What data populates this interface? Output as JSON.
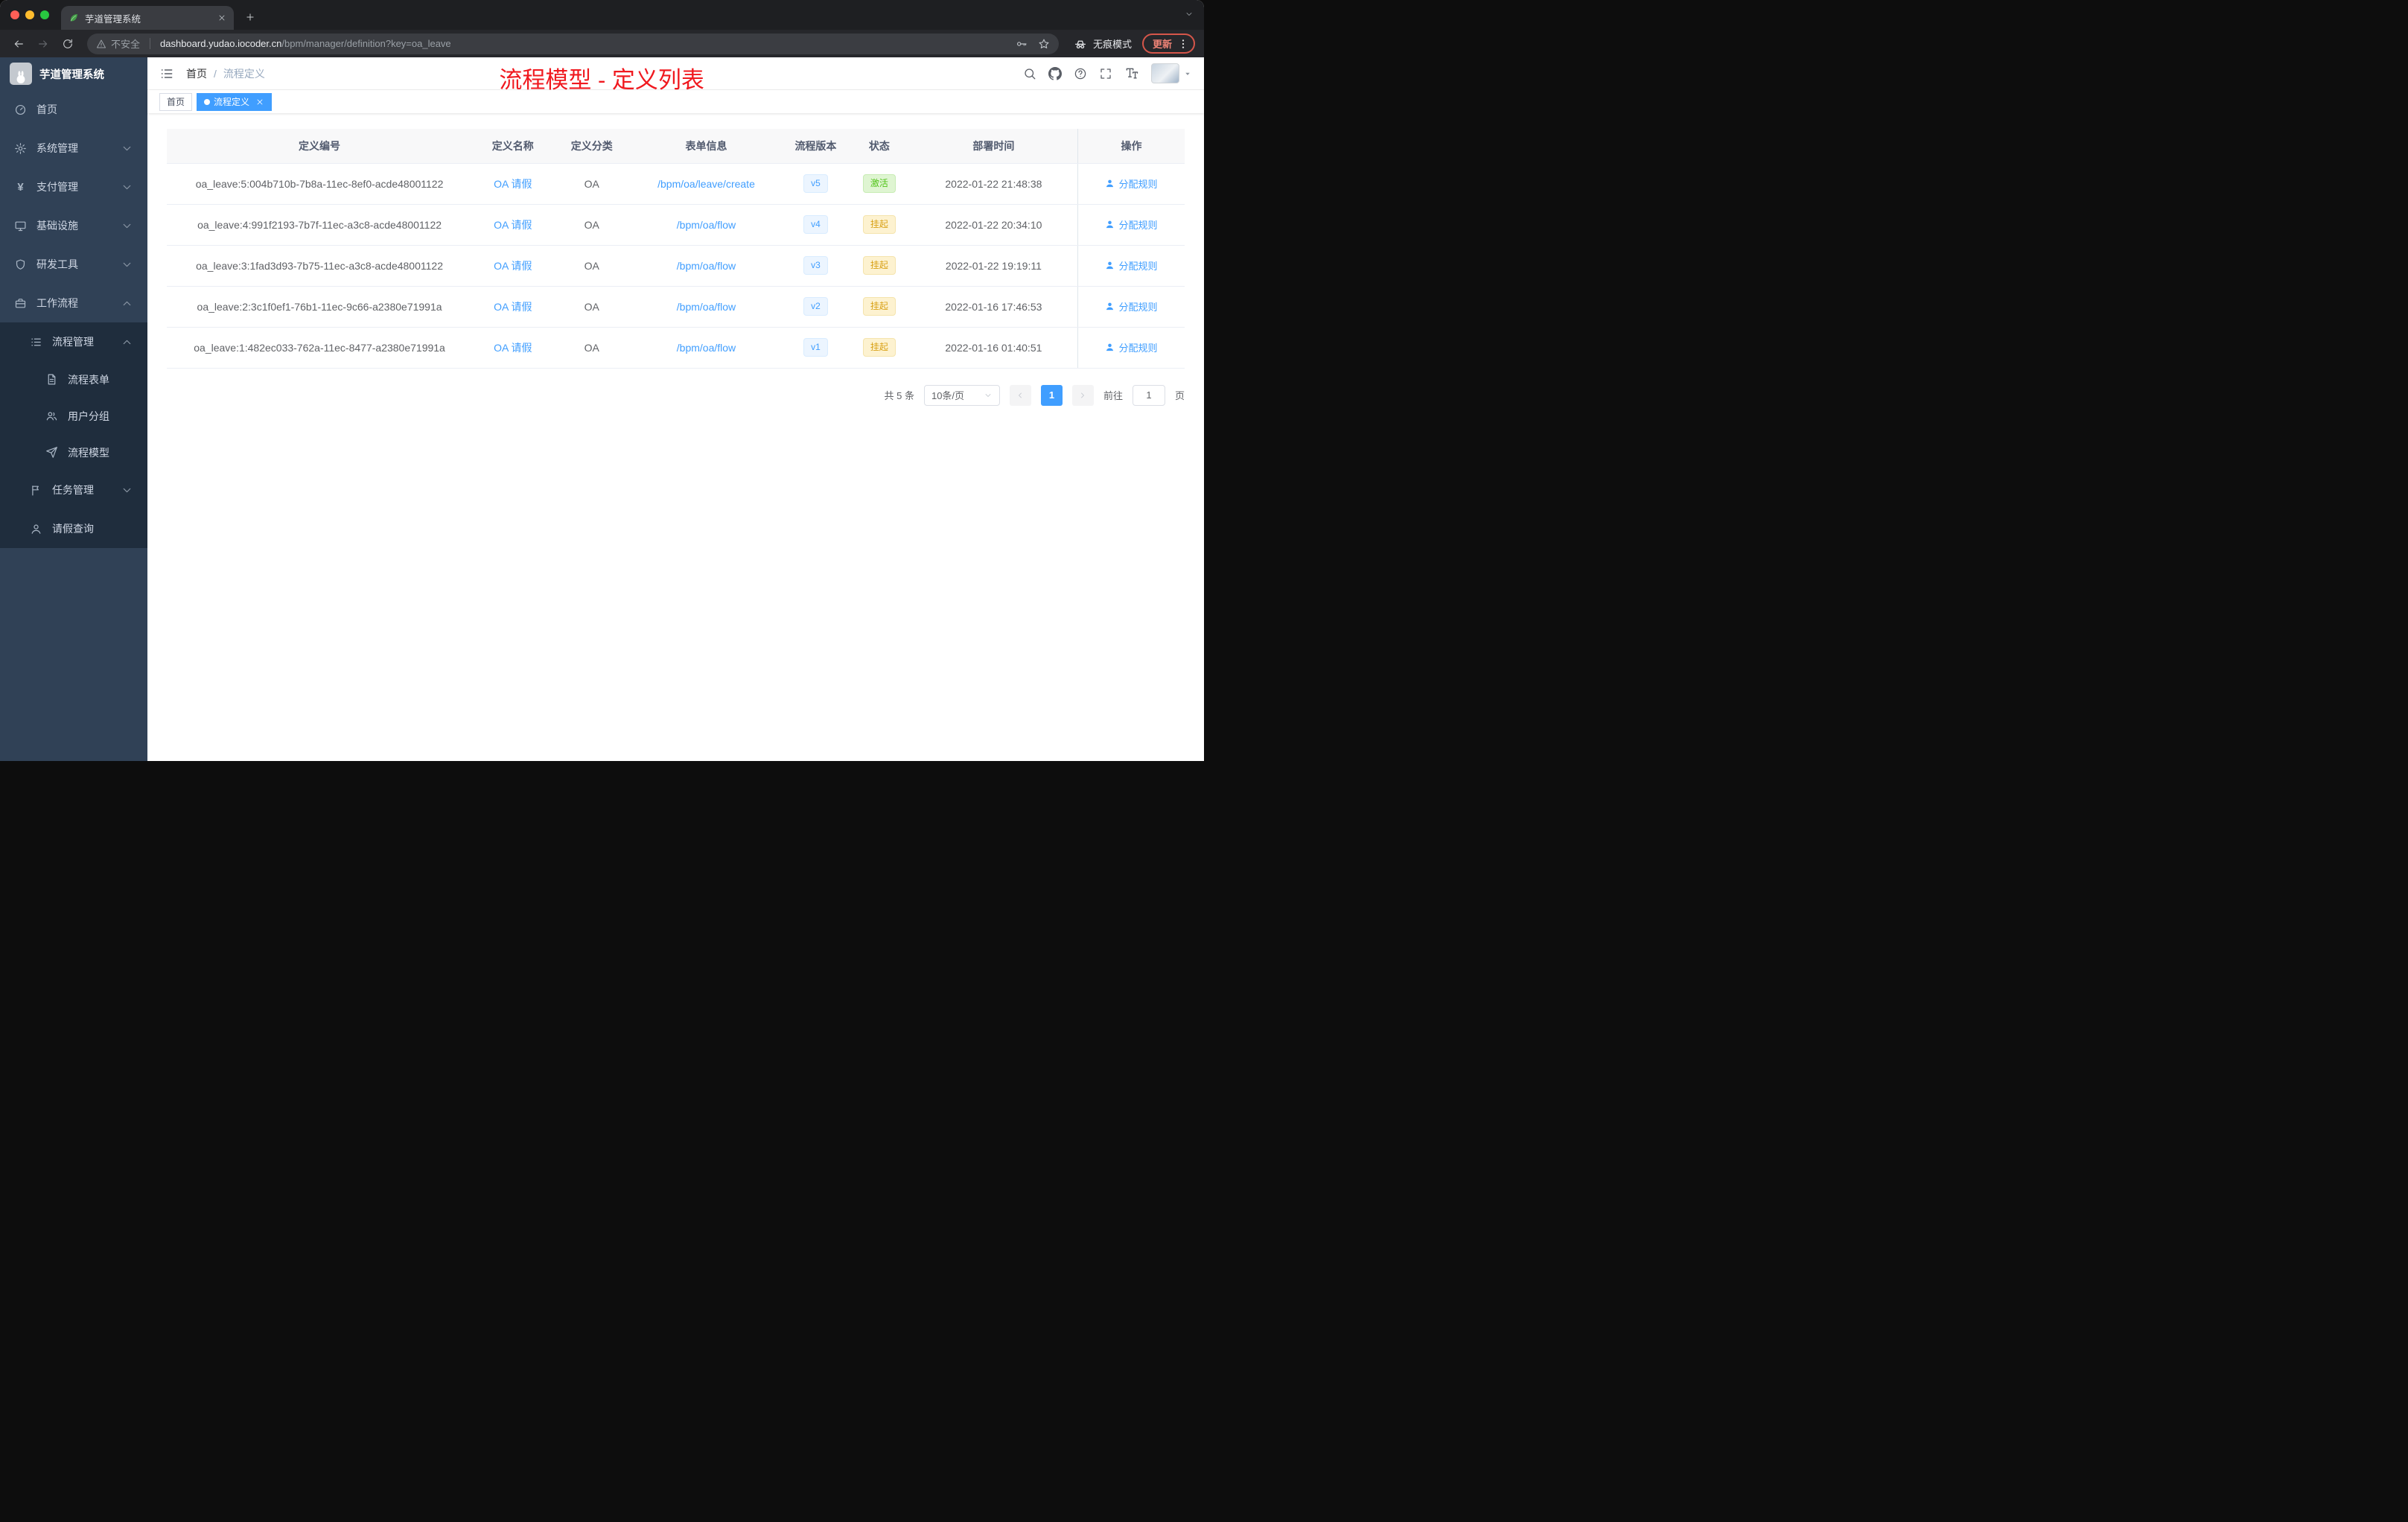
{
  "browser": {
    "tab": {
      "title": "芋道管理系统"
    },
    "address": {
      "security_label": "不安全",
      "url_domain": "dashboard.yudao.iocoder.cn",
      "url_path": "/bpm/manager/definition?key=oa_leave"
    },
    "incognito_label": "无痕模式",
    "update_label": "更新"
  },
  "sidebar": {
    "logo_title": "芋道管理系统",
    "items": [
      {
        "label": "首页"
      },
      {
        "label": "系统管理"
      },
      {
        "label": "支付管理"
      },
      {
        "label": "基础设施"
      },
      {
        "label": "研发工具"
      },
      {
        "label": "工作流程"
      }
    ],
    "submenu": {
      "process_management": "流程管理",
      "children": [
        {
          "label": "流程表单"
        },
        {
          "label": "用户分组"
        },
        {
          "label": "流程模型"
        }
      ],
      "task_management": "任务管理",
      "leave_query": "请假查询"
    }
  },
  "header": {
    "breadcrumb": {
      "home": "首页",
      "separator": "/",
      "current": "流程定义"
    },
    "annotation": "流程模型 - 定义列表"
  },
  "tags": {
    "home": "首页",
    "active": "流程定义"
  },
  "table": {
    "columns": [
      "定义编号",
      "定义名称",
      "定义分类",
      "表单信息",
      "流程版本",
      "状态",
      "部署时间",
      "操作"
    ],
    "rows": [
      {
        "id": "oa_leave:5:004b710b-7b8a-11ec-8ef0-acde48001122",
        "name": "OA 请假",
        "category": "OA",
        "form": "/bpm/oa/leave/create",
        "version": "v5",
        "status": "激活",
        "status_type": "active",
        "deployed_at": "2022-01-22 21:48:38",
        "action": "分配规则"
      },
      {
        "id": "oa_leave:4:991f2193-7b7f-11ec-a3c8-acde48001122",
        "name": "OA 请假",
        "category": "OA",
        "form": "/bpm/oa/flow",
        "version": "v4",
        "status": "挂起",
        "status_type": "suspended",
        "deployed_at": "2022-01-22 20:34:10",
        "action": "分配规则"
      },
      {
        "id": "oa_leave:3:1fad3d93-7b75-11ec-a3c8-acde48001122",
        "name": "OA 请假",
        "category": "OA",
        "form": "/bpm/oa/flow",
        "version": "v3",
        "status": "挂起",
        "status_type": "suspended",
        "deployed_at": "2022-01-22 19:19:11",
        "action": "分配规则"
      },
      {
        "id": "oa_leave:2:3c1f0ef1-76b1-11ec-9c66-a2380e71991a",
        "name": "OA 请假",
        "category": "OA",
        "form": "/bpm/oa/flow",
        "version": "v2",
        "status": "挂起",
        "status_type": "suspended",
        "deployed_at": "2022-01-16 17:46:53",
        "action": "分配规则"
      },
      {
        "id": "oa_leave:1:482ec033-762a-11ec-8477-a2380e71991a",
        "name": "OA 请假",
        "category": "OA",
        "form": "/bpm/oa/flow",
        "version": "v1",
        "status": "挂起",
        "status_type": "suspended",
        "deployed_at": "2022-01-16 01:40:51",
        "action": "分配规则"
      }
    ]
  },
  "pagination": {
    "total": "共 5 条",
    "page_size": "10条/页",
    "current_page": "1",
    "goto_label": "前往",
    "goto_value": "1",
    "page_unit": "页"
  },
  "colors": {
    "accent": "#409eff",
    "annotation_red": "#f0191f",
    "status_active": "#52c41a",
    "status_suspended": "#d9a116",
    "sidebar_bg": "#304156",
    "submenu_bg": "#1f2d3d"
  }
}
